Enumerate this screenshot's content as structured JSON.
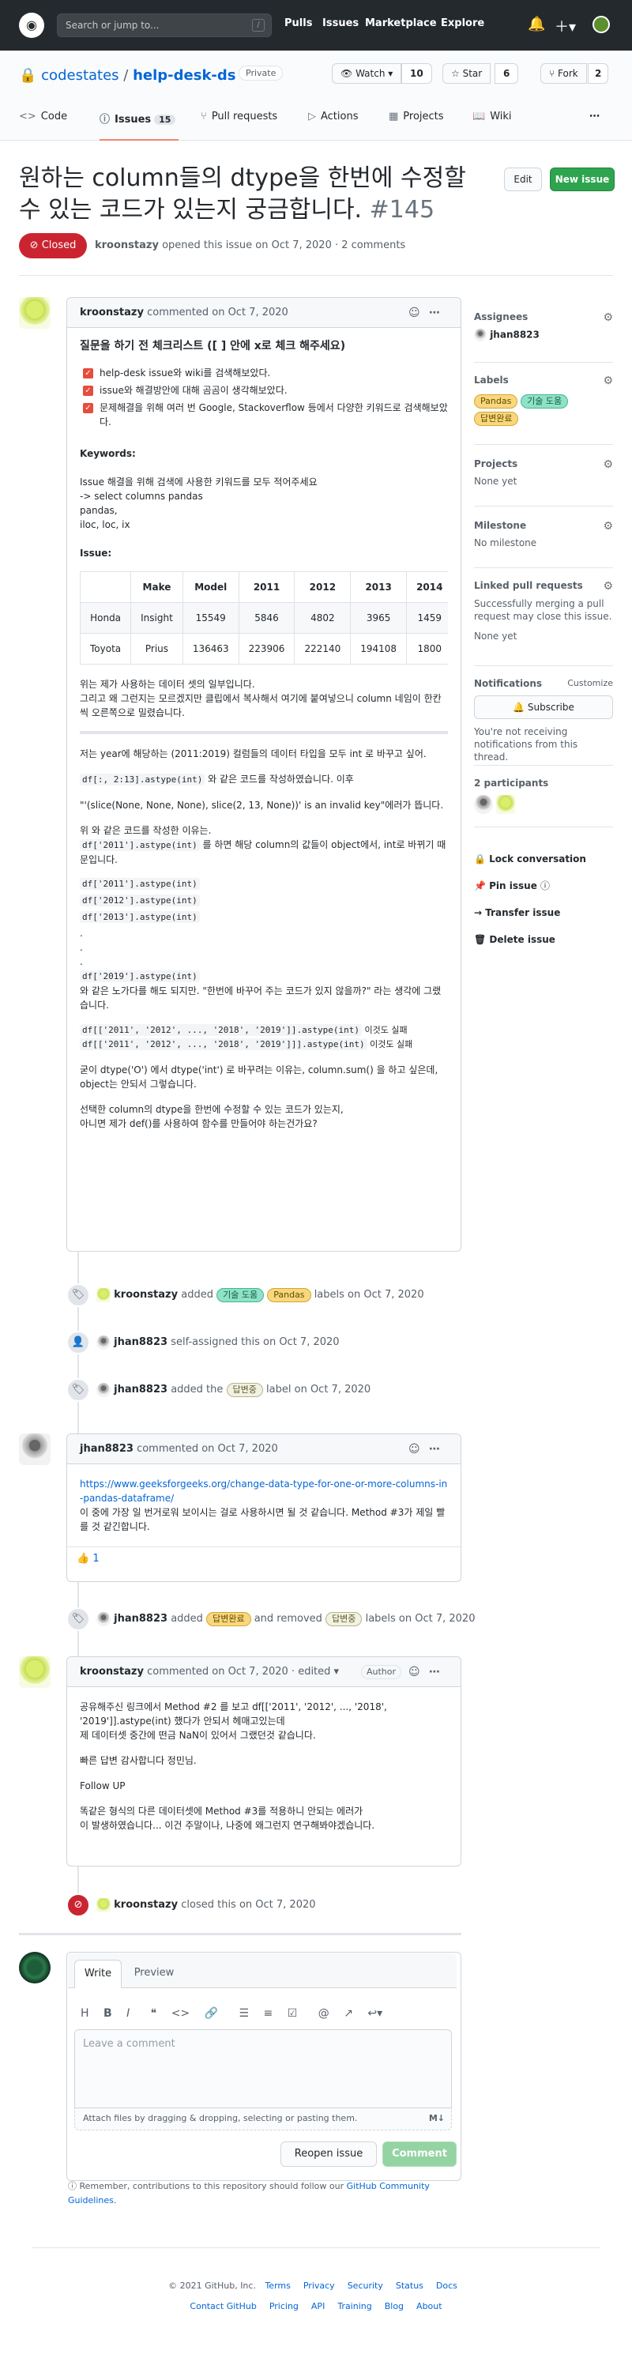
{
  "header": {
    "search_placeholder": "Search or jump to...",
    "search_key": "/",
    "nav": [
      "Pulls",
      "Issues",
      "Marketplace",
      "Explore"
    ]
  },
  "repo": {
    "owner": "codestates",
    "sep": "/",
    "name": "help-desk-ds",
    "visibility": "Private",
    "watch_label": "Watch",
    "watch_count": "10",
    "star_label": "Star",
    "star_count": "6",
    "fork_label": "Fork",
    "fork_count": "2"
  },
  "tabs": [
    {
      "label": "Code"
    },
    {
      "label": "Issues",
      "count": "15"
    },
    {
      "label": "Pull requests"
    },
    {
      "label": "Actions"
    },
    {
      "label": "Projects"
    },
    {
      "label": "Wiki"
    }
  ],
  "issue": {
    "title": "원하는 column들의 dtype을 한번에 수정할 수 있는 코드가 있는지 궁금합니다.",
    "number": "#145",
    "state": "Closed",
    "author": "kroonstazy",
    "opened_text": "opened this issue on Oct 7, 2020 · 2 comments",
    "edit_label": "Edit",
    "new_issue_label": "New issue"
  },
  "first_comment": {
    "author": "kroonstazy",
    "date_text": "commented on Oct 7, 2020",
    "checklist_title": "질문을 하기 전 체크리스트 ([ ] 안에 x로 체크 해주세요)",
    "checklist": [
      "help-desk issue와 wiki를 검색해보았다.",
      "issue와 해결방안에 대해 곰곰이 생각해보았다.",
      "문제해결을 위해 여러 번 Google, Stackoverflow 등에서 다양한 키워드로 검색해보았다."
    ],
    "keywords_label": "Keywords:",
    "keywords_lines": [
      "Issue 해결을 위해 검색에 사용한 키워드를 모두 적어주세요",
      "-> select columns pandas",
      "pandas,",
      "iloc, loc, ix"
    ],
    "issue_label": "Issue:",
    "table": {
      "headers": [
        "",
        "Make",
        "Model",
        "2011",
        "2012",
        "2013",
        "2014"
      ],
      "rows": [
        [
          "Honda",
          "Insight",
          "15549",
          "5846",
          "4802",
          "3965",
          "1459"
        ],
        [
          "Toyota",
          "Prius",
          "136463",
          "223906",
          "222140",
          "194108",
          "1800"
        ]
      ]
    },
    "para1": [
      "위는 제가 사용하는 데이터 셋의 일부입니다.",
      "그리고 왜 그런지는 모르겠지만 클립에서 복사해서 여기에 붙여넣으니 column 네임이 한칸씩 오른쪽으로 밀렸습니다."
    ],
    "para2": "저는 year에 해당하는 (2011:2019) 컬럼들의 데이터 타입을 모두 int 로 바꾸고 싶어.",
    "para3_code": "df[:, 2:13].astype(int)",
    "para3_text": " 와 같은 코드를 작성하였습니다. 이후",
    "para4": "\"'(slice(None, None, None), slice(2, 13, None))' is an invalid key\"에러가 뜹니다.",
    "para5_a": "위 와 같은 코드를 작성한 이유는.",
    "para5_code": "df['2011'].astype(int)",
    "para5_text": " 를 하면 해당 column의 값들이 object에서, int로 바뀌기 때문입니다.",
    "code_lines": [
      "df['2011'].astype(int)",
      "df['2012'].astype(int)",
      "df['2013'].astype(int)"
    ],
    "dots": [
      ".",
      ".",
      "."
    ],
    "code_last": "df['2019'].astype(int)",
    "para6": "와 같은 노가다를 해도 되지만. \"한번에 바꾸어 주는 코드가 있지 않을까?\" 라는 생각에 그랬습니다.",
    "fail1_code": "df[['2011', '2012', ..., '2018', '2019']].astype(int)",
    "fail1_text": " 이것도 실패",
    "fail2_code": "df[['2011', '2012', ..., '2018', '2019']]].astype(int)",
    "fail2_text": " 이것도 실패",
    "para7": "굳이 dtype('O') 에서 dtype('int') 로 바꾸려는 이유는, column.sum() 을 하고 싶은데, object는 안되서 그렇습니다.",
    "para8": [
      "선택한 column의 dtype을 한번에 수정할 수 있는 코드가 있는지,",
      "아니면 제가 def()를 사용하여 함수를 만들어야 하는건가요?"
    ]
  },
  "events": {
    "e1": {
      "actor": "kroonstazy",
      "verb": "added",
      "labels": [
        "기술 도움",
        "Pandas"
      ],
      "suffix": "labels on Oct 7, 2020"
    },
    "e2": {
      "actor": "jhan8823",
      "text": "self-assigned this on Oct 7, 2020"
    },
    "e3": {
      "actor": "jhan8823",
      "verb": "added the",
      "label": "답변중",
      "suffix": "label on Oct 7, 2020"
    },
    "e4": {
      "actor": "jhan8823",
      "verb": "added",
      "label_add": "답변완료",
      "mid": "and removed",
      "label_rem": "답변중",
      "suffix": "labels on Oct 7, 2020"
    },
    "e5": {
      "actor": "kroonstazy",
      "text": "closed this on Oct 7, 2020"
    }
  },
  "comment2": {
    "author": "jhan8823",
    "date_text": "commented on Oct 7, 2020",
    "link": "https://www.geeksforgeeks.org/change-data-type-for-one-or-more-columns-in-pandas-dataframe/",
    "text": "이 중에 가장 일 번거로워 보이시는 걸로 사용하시면 될 것 같습니다. Method #3가 제일 빨를 것 같긴합니다.",
    "reaction_emoji": "👍",
    "reaction_count": "1"
  },
  "comment3": {
    "author": "kroonstazy",
    "date_text": "commented on Oct 7, 2020 · edited",
    "badge": "Author",
    "lines": [
      "공유해주신 링크에서 Method #2 를 보고 df[['2011', '2012', ..., '2018', '2019']].astype(int) 했다가 안되서 헤매고있는데",
      "제 데이터셋 중간에 떤금 NaN이 있어서 그랬던것 같습니다."
    ],
    "line2": "빠른 답변 감사합니다 정민님.",
    "line3": "Follow UP",
    "line4": [
      "똑같은 형식의 다른 데이터셋에 Method #3를 적용하니 안되는 에러가",
      "이 발생하였습니다... 이건 주말이나, 나중에 왜그런지 연구해봐야겠습니다."
    ]
  },
  "sidebar": {
    "assignees_h": "Assignees",
    "assignee": "jhan8823",
    "labels_h": "Labels",
    "labels": [
      "Pandas",
      "기술 도움",
      "답변완료"
    ],
    "projects_h": "Projects",
    "projects_val": "None yet",
    "milestone_h": "Milestone",
    "milestone_val": "No milestone",
    "linked_h": "Linked pull requests",
    "linked_desc": "Successfully merging a pull request may close this issue.",
    "linked_val": "None yet",
    "notif_h": "Notifications",
    "customize": "Customize",
    "subscribe": "Subscribe",
    "notif_desc": "You're not receiving notifications from this thread.",
    "participants_h": "2 participants",
    "actions": [
      "Lock conversation",
      "Pin issue",
      "Transfer issue",
      "Delete issue"
    ]
  },
  "form": {
    "write": "Write",
    "preview": "Preview",
    "placeholder": "Leave a comment",
    "attach": "Attach files by dragging & dropping, selecting or pasting them.",
    "md": "M↓",
    "reopen": "Reopen issue",
    "comment": "Comment",
    "remember": "Remember, contributions to this repository should follow our",
    "guidelines": "GitHub Community Guidelines."
  },
  "footer": {
    "copyright": "© 2021 GitHub, Inc.",
    "row1": [
      "Terms",
      "Privacy",
      "Security",
      "Status",
      "Docs"
    ],
    "row2": [
      "Contact GitHub",
      "Pricing",
      "API",
      "Training",
      "Blog",
      "About"
    ]
  }
}
